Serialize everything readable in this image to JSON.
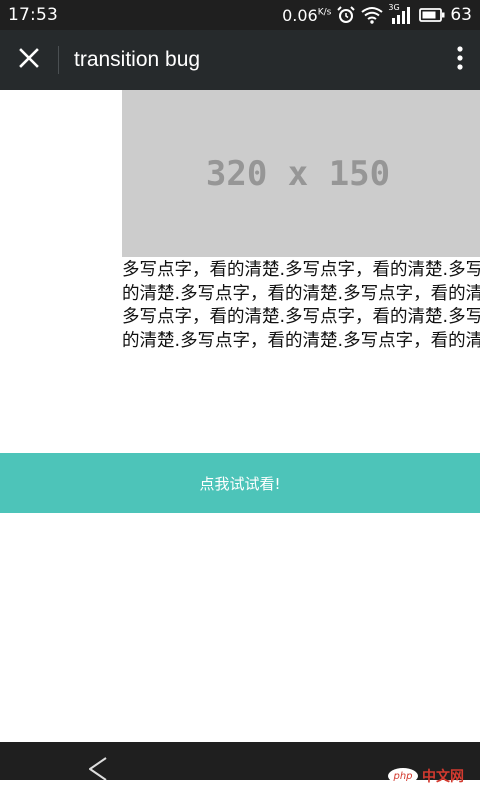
{
  "status_bar": {
    "time": "17:53",
    "net_speed": "0.06",
    "net_unit": "K/s",
    "signal_type": "3G",
    "battery": "63",
    "icons": [
      "alarm-icon",
      "wifi-icon",
      "signal-icon",
      "battery-icon"
    ]
  },
  "title_bar": {
    "title": "transition bug",
    "close_icon": "close-icon",
    "menu_icon": "overflow-menu-icon"
  },
  "content": {
    "image_label": "320 x 150",
    "text_lines": [
      "多写点字，看的清楚.多写点字，看的清楚.多写点字，看",
      "的清楚.多写点字，看的清楚.多写点字，看的清楚.多写点字，看",
      "多写点字，看的清楚.多写点字，看的清楚.多写点字，看",
      "的清楚.多写点字，看的清楚.多写点字，看的清楚.多写点字，看"
    ],
    "button_label": "点我试试看!"
  },
  "nav_bar": {
    "back_icon": "back-icon",
    "watermark_badge": "php",
    "watermark_text": "中文网"
  },
  "colors": {
    "status_bg": "#1f1f1f",
    "toolbar_bg": "#262a2c",
    "placeholder_bg": "#cccccc",
    "placeholder_text": "#969696",
    "accent": "#4dc4b9"
  }
}
